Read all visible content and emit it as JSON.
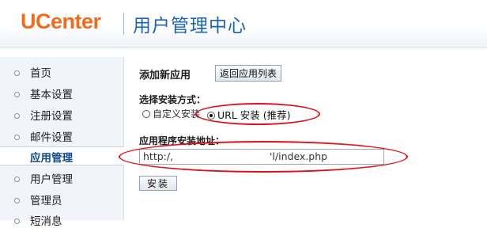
{
  "header": {
    "logo": "UCenter",
    "title": "用户管理中心"
  },
  "sidebar": {
    "items": [
      {
        "label": "首页"
      },
      {
        "label": "基本设置"
      },
      {
        "label": "注册设置"
      },
      {
        "label": "邮件设置"
      },
      {
        "label": "应用管理"
      },
      {
        "label": "用户管理"
      },
      {
        "label": "管理员"
      },
      {
        "label": "短消息"
      }
    ],
    "active": "应用管理"
  },
  "main": {
    "section_title": "添加新应用",
    "back_button": "返回应用列表",
    "install_type_label": "选择安装方式：",
    "install_options": [
      {
        "label": "自定义安装",
        "checked": false
      },
      {
        "label": "URL 安装 (推荐)",
        "checked": true
      }
    ],
    "address_label": "应用程序安装地址：",
    "url_prefix": "http:/,",
    "url_suffix": "'l/index.php",
    "install_button": "安装"
  },
  "colors": {
    "logo": "#f26b1d",
    "title": "#1a63b5",
    "annotation": "#e0101c"
  }
}
